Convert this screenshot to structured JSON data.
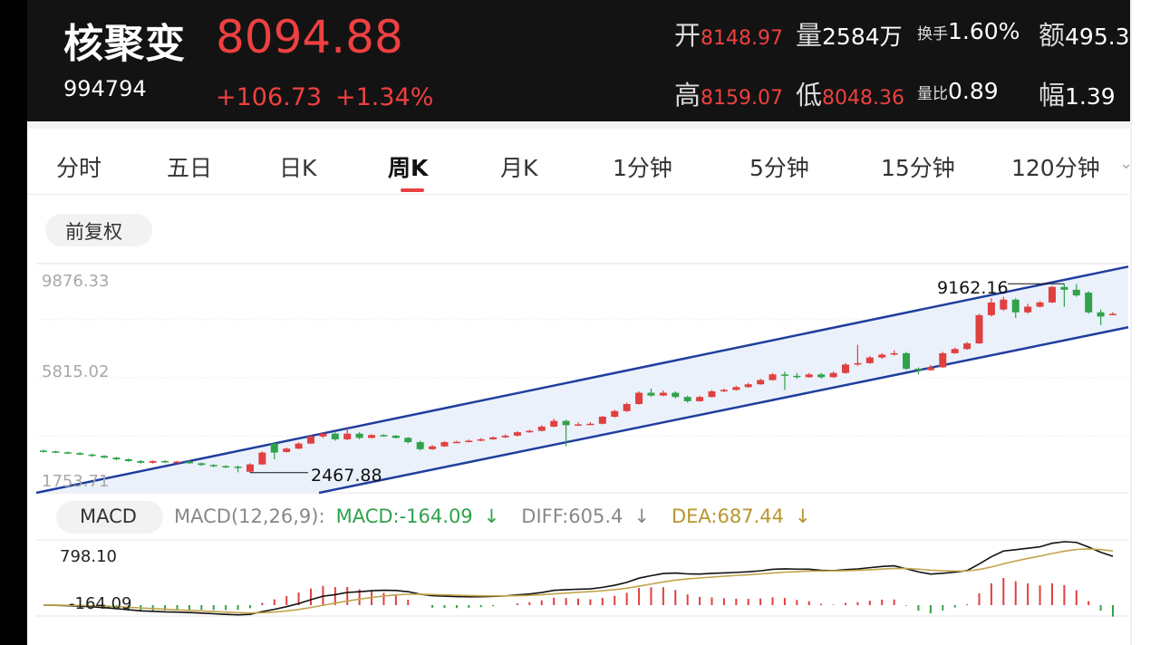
{
  "stock": {
    "name": "核聚变",
    "code": "994794",
    "price": "8094.88",
    "change": "+106.73",
    "change_pct": "+1.34%"
  },
  "stats": {
    "open_label": "开",
    "open": "8148.97",
    "volume_label": "量",
    "volume": "2584万",
    "turnover_label": "换手",
    "turnover": "1.60%",
    "amount_label": "额",
    "amount": "495.3",
    "high_label": "高",
    "high": "8159.07",
    "low_label": "低",
    "low": "8048.36",
    "vol_ratio_label": "量比",
    "vol_ratio": "0.89",
    "amplitude_label": "幅",
    "amplitude": "1.39"
  },
  "tabs": [
    "分时",
    "五日",
    "日K",
    "周K",
    "月K",
    "1分钟",
    "5分钟",
    "15分钟",
    "120分钟"
  ],
  "active_tab": "周K",
  "adjust_label": "前复权",
  "colors": {
    "up": "#e04040",
    "down": "#2fa24a",
    "channel": "#1f3e9e",
    "channel_fill": "#eaf1fb",
    "diff": "#111111",
    "dea": "#c2a34a"
  },
  "chart_data": {
    "type": "candlestick",
    "ylim": [
      1753.71,
      9876.33
    ],
    "y_ticks": [
      "9876.33",
      "5815.02",
      "1753.71"
    ],
    "annotations": {
      "high": "9162.16",
      "low": "2467.88"
    },
    "candles": [
      {
        "o": 3250,
        "c": 3220,
        "h": 3280,
        "l": 3180
      },
      {
        "o": 3220,
        "c": 3190,
        "h": 3250,
        "l": 3160
      },
      {
        "o": 3190,
        "c": 3160,
        "h": 3220,
        "l": 3130
      },
      {
        "o": 3160,
        "c": 3110,
        "h": 3200,
        "l": 3090
      },
      {
        "o": 3110,
        "c": 3060,
        "h": 3140,
        "l": 3030
      },
      {
        "o": 3060,
        "c": 3000,
        "h": 3090,
        "l": 2980
      },
      {
        "o": 3000,
        "c": 2940,
        "h": 3030,
        "l": 2910
      },
      {
        "o": 2940,
        "c": 2880,
        "h": 2970,
        "l": 2850
      },
      {
        "o": 2880,
        "c": 2820,
        "h": 2910,
        "l": 2790
      },
      {
        "o": 2820,
        "c": 2880,
        "h": 2900,
        "l": 2790
      },
      {
        "o": 2880,
        "c": 2840,
        "h": 2910,
        "l": 2810
      },
      {
        "o": 2840,
        "c": 2860,
        "h": 2890,
        "l": 2800
      },
      {
        "o": 2860,
        "c": 2800,
        "h": 2890,
        "l": 2780
      },
      {
        "o": 2800,
        "c": 2740,
        "h": 2830,
        "l": 2710
      },
      {
        "o": 2740,
        "c": 2700,
        "h": 2770,
        "l": 2660
      },
      {
        "o": 2700,
        "c": 2660,
        "h": 2730,
        "l": 2630
      },
      {
        "o": 2680,
        "c": 2640,
        "h": 2720,
        "l": 2480
      },
      {
        "o": 2500,
        "c": 2760,
        "h": 2800,
        "l": 2468
      },
      {
        "o": 2760,
        "c": 3180,
        "h": 3220,
        "l": 2740
      },
      {
        "o": 3500,
        "c": 3180,
        "h": 3520,
        "l": 2940
      },
      {
        "o": 3200,
        "c": 3320,
        "h": 3360,
        "l": 3180
      },
      {
        "o": 3320,
        "c": 3500,
        "h": 3540,
        "l": 3300
      },
      {
        "o": 3500,
        "c": 3750,
        "h": 3800,
        "l": 3480
      },
      {
        "o": 3750,
        "c": 3850,
        "h": 3900,
        "l": 3700
      },
      {
        "o": 3850,
        "c": 3650,
        "h": 3900,
        "l": 3600
      },
      {
        "o": 3650,
        "c": 3850,
        "h": 4100,
        "l": 3620
      },
      {
        "o": 3850,
        "c": 3700,
        "h": 3900,
        "l": 3650
      },
      {
        "o": 3700,
        "c": 3800,
        "h": 3830,
        "l": 3680
      },
      {
        "o": 3800,
        "c": 3780,
        "h": 3830,
        "l": 3740
      },
      {
        "o": 3780,
        "c": 3700,
        "h": 3800,
        "l": 3680
      },
      {
        "o": 3700,
        "c": 3550,
        "h": 3730,
        "l": 3500
      },
      {
        "o": 3550,
        "c": 3300,
        "h": 3600,
        "l": 3250
      },
      {
        "o": 3300,
        "c": 3400,
        "h": 3450,
        "l": 3270
      },
      {
        "o": 3400,
        "c": 3550,
        "h": 3580,
        "l": 3380
      },
      {
        "o": 3550,
        "c": 3560,
        "h": 3600,
        "l": 3520
      },
      {
        "o": 3560,
        "c": 3600,
        "h": 3640,
        "l": 3540
      },
      {
        "o": 3600,
        "c": 3650,
        "h": 3690,
        "l": 3580
      },
      {
        "o": 3650,
        "c": 3720,
        "h": 3750,
        "l": 3630
      },
      {
        "o": 3720,
        "c": 3780,
        "h": 3820,
        "l": 3700
      },
      {
        "o": 3780,
        "c": 3900,
        "h": 3940,
        "l": 3750
      },
      {
        "o": 3900,
        "c": 3950,
        "h": 3990,
        "l": 3880
      },
      {
        "o": 3950,
        "c": 4100,
        "h": 4150,
        "l": 3930
      },
      {
        "o": 4100,
        "c": 4300,
        "h": 4380,
        "l": 4080
      },
      {
        "o": 4300,
        "c": 4150,
        "h": 4350,
        "l": 3400
      },
      {
        "o": 4150,
        "c": 4180,
        "h": 4250,
        "l": 4120
      },
      {
        "o": 4180,
        "c": 4200,
        "h": 4260,
        "l": 4150
      },
      {
        "o": 4200,
        "c": 4450,
        "h": 4480,
        "l": 4180
      },
      {
        "o": 4450,
        "c": 4650,
        "h": 4700,
        "l": 4420
      },
      {
        "o": 4650,
        "c": 4900,
        "h": 4950,
        "l": 4620
      },
      {
        "o": 4900,
        "c": 5300,
        "h": 5350,
        "l": 4880
      },
      {
        "o": 5300,
        "c": 5200,
        "h": 5450,
        "l": 5150
      },
      {
        "o": 5200,
        "c": 5300,
        "h": 5380,
        "l": 5180
      },
      {
        "o": 5300,
        "c": 5150,
        "h": 5350,
        "l": 5100
      },
      {
        "o": 5150,
        "c": 5000,
        "h": 5200,
        "l": 4950
      },
      {
        "o": 5000,
        "c": 5150,
        "h": 5200,
        "l": 4980
      },
      {
        "o": 5150,
        "c": 5350,
        "h": 5400,
        "l": 5130
      },
      {
        "o": 5350,
        "c": 5400,
        "h": 5450,
        "l": 5320
      },
      {
        "o": 5400,
        "c": 5500,
        "h": 5550,
        "l": 5380
      },
      {
        "o": 5500,
        "c": 5600,
        "h": 5650,
        "l": 5480
      },
      {
        "o": 5600,
        "c": 5750,
        "h": 5800,
        "l": 5580
      },
      {
        "o": 5750,
        "c": 5950,
        "h": 6000,
        "l": 5730
      },
      {
        "o": 5950,
        "c": 5900,
        "h": 6050,
        "l": 5400
      },
      {
        "o": 5900,
        "c": 5850,
        "h": 6000,
        "l": 5800
      },
      {
        "o": 5850,
        "c": 5950,
        "h": 6000,
        "l": 5830
      },
      {
        "o": 5950,
        "c": 5850,
        "h": 6000,
        "l": 5800
      },
      {
        "o": 5850,
        "c": 6000,
        "h": 6050,
        "l": 5830
      },
      {
        "o": 6000,
        "c": 6300,
        "h": 6350,
        "l": 5980
      },
      {
        "o": 6300,
        "c": 6350,
        "h": 7000,
        "l": 6250
      },
      {
        "o": 6350,
        "c": 6550,
        "h": 6600,
        "l": 6320
      },
      {
        "o": 6550,
        "c": 6650,
        "h": 6700,
        "l": 6500
      },
      {
        "o": 6650,
        "c": 6700,
        "h": 6800,
        "l": 6620
      },
      {
        "o": 6700,
        "c": 6150,
        "h": 6750,
        "l": 6100
      },
      {
        "o": 6150,
        "c": 6100,
        "h": 6200,
        "l": 5950
      },
      {
        "o": 6100,
        "c": 6200,
        "h": 6280,
        "l": 6080
      },
      {
        "o": 6200,
        "c": 6700,
        "h": 6750,
        "l": 6180
      },
      {
        "o": 6700,
        "c": 6850,
        "h": 6900,
        "l": 6680
      },
      {
        "o": 6850,
        "c": 7050,
        "h": 7100,
        "l": 6820
      },
      {
        "o": 7050,
        "c": 8050,
        "h": 8100,
        "l": 7030
      },
      {
        "o": 8050,
        "c": 8500,
        "h": 8650,
        "l": 8000
      },
      {
        "o": 8250,
        "c": 8600,
        "h": 8700,
        "l": 8200
      },
      {
        "o": 8600,
        "c": 8150,
        "h": 8650,
        "l": 7950
      },
      {
        "o": 8150,
        "c": 8350,
        "h": 8450,
        "l": 8100
      },
      {
        "o": 8350,
        "c": 8500,
        "h": 8550,
        "l": 8320
      },
      {
        "o": 8500,
        "c": 9050,
        "h": 9100,
        "l": 8480
      },
      {
        "o": 9050,
        "c": 8950,
        "h": 9162,
        "l": 8350
      },
      {
        "o": 8950,
        "c": 8750,
        "h": 9150,
        "l": 8700
      },
      {
        "o": 8850,
        "c": 8150,
        "h": 8900,
        "l": 8100
      },
      {
        "o": 8150,
        "c": 8000,
        "h": 8250,
        "l": 7700
      },
      {
        "o": 8050,
        "c": 8095,
        "h": 8159,
        "l": 8048
      }
    ],
    "channel": {
      "lower": [
        [
          0,
          1753.71
        ],
        [
          85,
          7620
        ]
      ],
      "upper": [
        [
          0,
          1753.71
        ],
        [
          85,
          9770
        ]
      ]
    }
  },
  "macd": {
    "label": "MACD",
    "params": "MACD(12,26,9):",
    "macd_value": "MACD:-164.09",
    "diff_value": "DIFF:605.4",
    "dea_value": "DEA:687.44",
    "arrow": "↓",
    "y_top": "798.10",
    "y_bottom": "-164.09"
  }
}
